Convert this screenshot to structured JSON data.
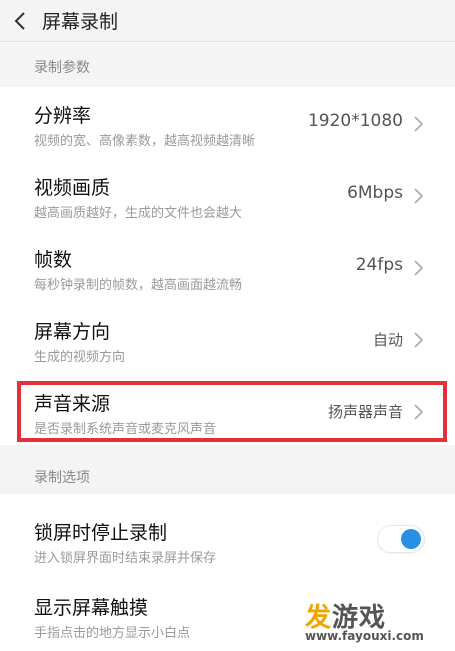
{
  "header": {
    "title": "屏幕录制"
  },
  "section_params": {
    "label": "录制参数"
  },
  "params": [
    {
      "title": "分辨率",
      "subtitle": "视频的宽、高像素数，越高视频越清晰",
      "value": "1920*1080"
    },
    {
      "title": "视频画质",
      "subtitle": "越高画质越好，生成的文件也会越大",
      "value": "6Mbps"
    },
    {
      "title": "帧数",
      "subtitle": "每秒钟录制的帧数，越高画面越流畅",
      "value": "24fps"
    },
    {
      "title": "屏幕方向",
      "subtitle": "生成的视频方向",
      "value": "自动"
    },
    {
      "title": "声音来源",
      "subtitle": "是否录制系统声音或麦克风声音",
      "value": "扬声器声音"
    }
  ],
  "section_options": {
    "label": "录制选项"
  },
  "options": [
    {
      "title": "锁屏时停止录制",
      "subtitle": "进入锁屏界面时结束录屏并保存",
      "enabled": true
    },
    {
      "title": "显示屏幕触摸",
      "subtitle": "手指点击的地方显示小白点"
    }
  ],
  "watermark": {
    "logo_a": "发",
    "logo_b": "游戏",
    "url": "www.fayouxi.com"
  },
  "colors": {
    "accent": "#2a8fe6",
    "highlight": "#e43039",
    "watermark": "#f0a500"
  }
}
